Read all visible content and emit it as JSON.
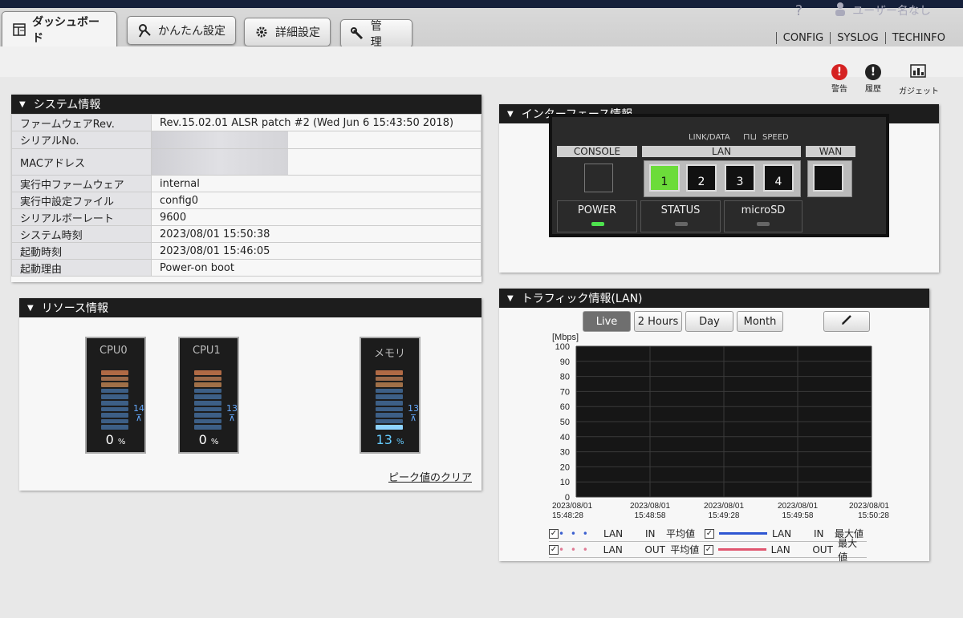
{
  "tabs": [
    {
      "label": "ダッシュボード",
      "icon": "dashboard-icon"
    },
    {
      "label": "かんたん設定",
      "icon": "wizard-icon"
    },
    {
      "label": "詳細設定",
      "icon": "gear-icon"
    },
    {
      "label": "管　理",
      "icon": "wrench-icon"
    }
  ],
  "header": {
    "help": "?",
    "user": "ユーザー名なし",
    "links": [
      "CONFIG",
      "SYSLOG",
      "TECHINFO"
    ]
  },
  "tools": [
    {
      "label": "警告",
      "icon": "warning-icon",
      "color": "#d52222",
      "glyph": "!"
    },
    {
      "label": "履歴",
      "icon": "history-icon",
      "color": "#222222",
      "glyph": "!"
    },
    {
      "label": "ガジェット",
      "icon": "gadget-icon"
    }
  ],
  "system": {
    "title": "システム情報",
    "rows": [
      {
        "key": "ファームウェアRev.",
        "value": "Rev.15.02.01 ALSR patch #2 (Wed Jun 6 15:43:50 2018)"
      },
      {
        "key": "シリアルNo.",
        "value": ""
      },
      {
        "key": "MACアドレス",
        "value": ""
      },
      {
        "key": "実行中ファームウェア",
        "value": "internal"
      },
      {
        "key": "実行中設定ファイル",
        "value": "config0"
      },
      {
        "key": "シリアルボーレート",
        "value": "9600"
      },
      {
        "key": "システム時刻",
        "value": "2023/08/01 15:50:38"
      },
      {
        "key": "起動時刻",
        "value": "2023/08/01 15:46:05"
      },
      {
        "key": "起動理由",
        "value": "Power-on boot"
      }
    ]
  },
  "resource": {
    "title": "リソース情報",
    "meters": [
      {
        "name": "CPU0",
        "percent": "0",
        "peak": "14",
        "level": 0
      },
      {
        "name": "CPU1",
        "percent": "0",
        "peak": "13",
        "level": 0
      },
      {
        "name": "メモリ",
        "percent": "13",
        "peak": "13",
        "level": 0.13
      }
    ],
    "unit": "%",
    "clear_link": "ピーク値のクリア"
  },
  "interface": {
    "title": "インターフェース情報",
    "link_data": "LINK/DATA",
    "speed": "SPEED",
    "console": "CONSOLE",
    "lan": "LAN",
    "wan": "WAN",
    "ports": [
      "1",
      "2",
      "3",
      "4"
    ],
    "power": "POWER",
    "status": "STATUS",
    "microsd": "microSD",
    "colors": {
      "active_port": "#6cdc3a",
      "power_led": "#4ee24e"
    }
  },
  "traffic": {
    "title": "トラフィック情報(LAN)",
    "ranges": [
      "Live",
      "2 Hours",
      "Day",
      "Month"
    ],
    "edit_icon": "pencil-icon",
    "legend": [
      {
        "iface": "LAN",
        "dir": "IN",
        "kind": "平均値",
        "color": "#3a5fcf"
      },
      {
        "iface": "LAN",
        "dir": "IN",
        "kind": "最大値",
        "color": "#2f56d2"
      },
      {
        "iface": "LAN",
        "dir": "OUT",
        "kind": "平均値",
        "color": "#e07a94"
      },
      {
        "iface": "LAN",
        "dir": "OUT",
        "kind": "最大値",
        "color": "#e0566f"
      }
    ]
  },
  "chart_data": {
    "type": "line",
    "title": "",
    "ylabel": "[Mbps]",
    "ylim": [
      0,
      100
    ],
    "yticks": [
      0,
      10,
      20,
      30,
      40,
      50,
      60,
      70,
      80,
      90,
      100
    ],
    "xticks": [
      {
        "date": "2023/08/01",
        "time": "15:48:28"
      },
      {
        "date": "2023/08/01",
        "time": "15:48:58"
      },
      {
        "date": "2023/08/01",
        "time": "15:49:28"
      },
      {
        "date": "2023/08/01",
        "time": "15:49:58"
      },
      {
        "date": "2023/08/01",
        "time": "15:50:28"
      }
    ],
    "series": [
      {
        "name": "LAN IN 平均値",
        "values": []
      },
      {
        "name": "LAN OUT 平均値",
        "values": []
      },
      {
        "name": "LAN IN 最大値",
        "values": []
      },
      {
        "name": "LAN OUT 最大値",
        "values": []
      }
    ],
    "grid": true
  }
}
